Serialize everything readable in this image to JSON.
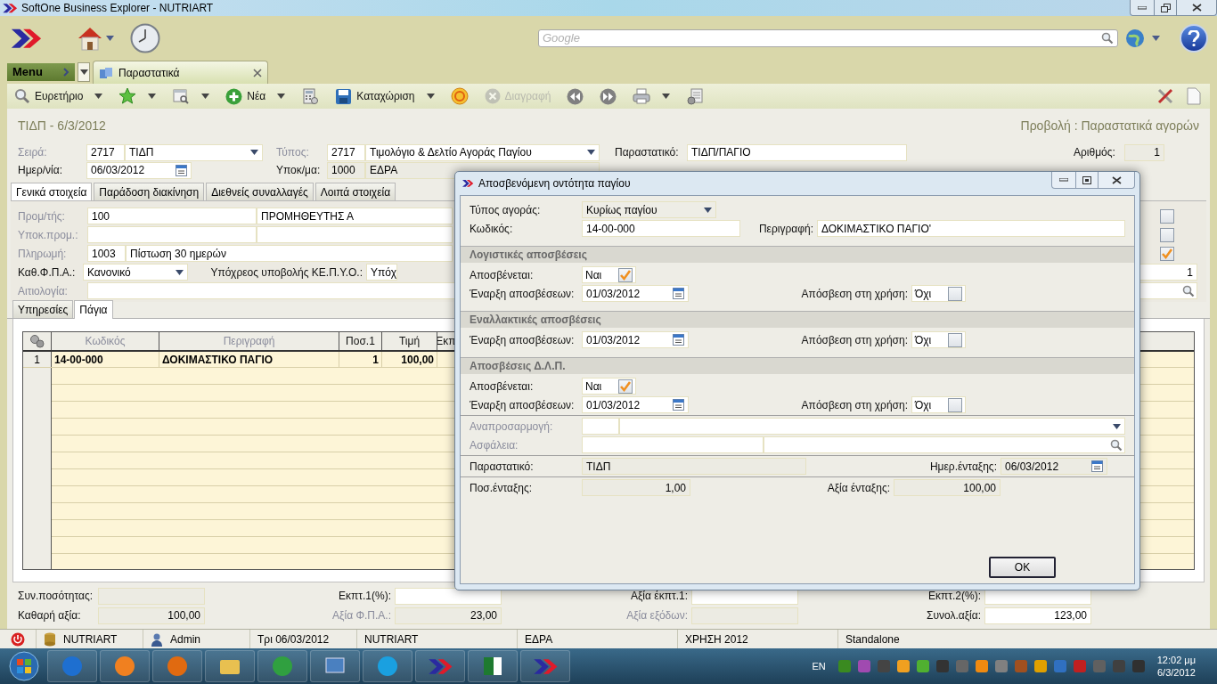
{
  "window": {
    "title": "SoftOne Business Explorer - NUTRIART"
  },
  "search": {
    "placeholder": "Google"
  },
  "menu_button": "Menu",
  "doc_tabs": [
    {
      "label": "Παραστατικά",
      "selected": true
    }
  ],
  "toolbar": [
    {
      "label": "Ευρετήριο",
      "dropdown": true,
      "disabled": false
    },
    {
      "dropdown": true,
      "disabled": false
    },
    {
      "dropdown": true,
      "disabled": false
    },
    {
      "label": "Νέα",
      "dropdown": true,
      "disabled": false
    },
    {
      "dropdown": false,
      "disabled": false
    },
    {
      "label": "Καταχώριση",
      "dropdown": true,
      "disabled": false
    },
    {
      "dropdown": false,
      "disabled": false
    },
    {
      "label": "Διαγραφή",
      "dropdown": false,
      "disabled": true
    },
    {
      "dropdown": false,
      "disabled": false
    },
    {
      "dropdown": false,
      "disabled": false
    },
    {
      "dropdown": true,
      "disabled": false
    },
    {
      "dropdown": false,
      "disabled": false
    }
  ],
  "form": {
    "title": "ΤΙΔΠ - 6/3/2012",
    "view": "Προβολή : Παραστατικά αγορών"
  },
  "header": {
    "series": {
      "label": "Σειρά:",
      "muted": true,
      "code": "2717",
      "value": "ΤΙΔΠ"
    },
    "type": {
      "label": "Τύπος:",
      "muted": true,
      "code": "2717",
      "value": "Τιμολόγιο & Δελτίο Αγοράς Παγίου"
    },
    "document": {
      "label": "Παραστατικό:",
      "muted": false,
      "value": "ΤΙΔΠ/ΠΑΓΙΟ"
    },
    "number": {
      "label": "Αριθμός:",
      "muted": false,
      "value": "1"
    },
    "date": {
      "label": "Ημερ/νία:",
      "muted": false,
      "value": "06/03/2012"
    },
    "branch": {
      "label": "Υποκ/μα:",
      "muted": false,
      "code": "1000",
      "value": "ΕΔΡΑ"
    }
  },
  "tabs": [
    {
      "label": "Γενικά στοιχεία",
      "selected": true
    },
    {
      "label": "Παράδοση διακίνηση",
      "selected": false
    },
    {
      "label": "Διεθνείς συναλλαγές",
      "selected": false
    },
    {
      "label": "Λοιπά στοιχεία",
      "selected": false
    }
  ],
  "general": [
    {
      "kind": "pair",
      "label": "Προμ/τής:",
      "muted": true,
      "code": "100",
      "value": "ΠΡΟΜΗΘΕΥΤΗΣ Α"
    },
    {
      "kind": "pair",
      "label": "Υποκ.προμ.:",
      "muted": true
    },
    {
      "kind": "pair",
      "label": "Πληρωμή:",
      "muted": true,
      "code": "1003",
      "value": "Πίστωση 30 ημερών"
    },
    {
      "kind": "select",
      "label": "Καθ.Φ.Π.Α.:",
      "muted": false,
      "value": "Κανονικό",
      "extra_label": "Υπόχρεος υποβολής ΚΕ.Π.Υ.Ο.:",
      "extra_value": "Υπόχ"
    },
    {
      "kind": "search",
      "label": "Αιτιολογία:",
      "muted": true
    }
  ],
  "side_checks": [
    {
      "checked": false
    },
    {
      "checked": false
    },
    {
      "checked": true
    }
  ],
  "side_value": "1",
  "sub_tabs": [
    {
      "label": "Υπηρεσίες",
      "selected": false
    },
    {
      "label": "Πάγια",
      "selected": true
    }
  ],
  "grid": {
    "columns": [
      {
        "label": "Κωδικός",
        "muted": true
      },
      {
        "label": "Περιγραφή",
        "muted": true
      },
      {
        "label": "Ποσ.1",
        "muted": false
      },
      {
        "label": "Τιμή",
        "muted": false
      },
      {
        "label": "Εκπ",
        "muted": false
      }
    ],
    "rows": [
      {
        "number": "1",
        "cells": [
          "14-00-000",
          "ΔΟΚΙΜΑΣΤΙΚΟ ΠΑΓΙΟ",
          "1",
          "100,00"
        ]
      }
    ]
  },
  "totals": [
    [
      {
        "label": "Συν.ποσότητας:",
        "muted": false,
        "editable": false
      },
      {
        "label": "Εκπτ.1(%):",
        "muted": false,
        "editable": true
      },
      {
        "label": "Αξία έκπτ.1:",
        "muted": false,
        "editable": true
      },
      {
        "label": "Εκπτ.2(%):",
        "muted": false,
        "editable": true
      }
    ],
    [
      {
        "label": "Καθαρή αξία:",
        "muted": false,
        "editable": false,
        "value": "100,00"
      },
      {
        "label": "Αξία Φ.Π.Α.:",
        "muted": true,
        "editable": false,
        "value": "23,00"
      },
      {
        "label": "Αξία εξόδων:",
        "muted": true,
        "editable": false
      },
      {
        "label": "Συνολ.αξία:",
        "muted": false,
        "editable": true,
        "value": "123,00"
      }
    ]
  ],
  "status_bar": [
    "NUTRIART",
    "Admin",
    "Τρι 06/03/2012",
    "NUTRIART",
    "ΕΔΡΑ",
    "ΧΡΗΣΗ 2012",
    "Standalone"
  ],
  "taskbar": {
    "language": "EN",
    "time": "12:02 μμ",
    "date": "6/3/2012"
  },
  "dialog": {
    "title": "Αποσβενόμενη οντότητα παγίου",
    "purchase_type": {
      "label": "Τύπος αγοράς:",
      "value": "Κυρίως παγίου"
    },
    "code": {
      "label": "Κωδικός:",
      "value": "14-00-000"
    },
    "description": {
      "label": "Περιγραφή:",
      "value": "ΔΟΚΙΜΑΣΤΙΚΟ ΠΑΓΙΟ'"
    },
    "sections": [
      {
        "title": "Λογιστικές αποσβέσεις",
        "depreciates": {
          "label": "Αποσβένεται:",
          "value": "Ναι",
          "checked": true
        },
        "start": {
          "label": "Έναρξη αποσβέσεων:",
          "value": "01/03/2012"
        },
        "in_use": {
          "label": "Απόσβεση στη χρήση:",
          "value": "Όχι",
          "checked": false
        }
      },
      {
        "title": "Εναλλακτικές αποσβέσεις",
        "start": {
          "label": "Έναρξη αποσβέσεων:",
          "value": "01/03/2012"
        },
        "in_use": {
          "label": "Απόσβεση στη χρήση:",
          "value": "Όχι",
          "checked": false
        }
      },
      {
        "title": "Αποσβέσεις Δ.Λ.Π.",
        "depreciates": {
          "label": "Αποσβένεται:",
          "value": "Ναι",
          "checked": true
        },
        "start": {
          "label": "Έναρξη αποσβέσεων:",
          "value": "01/03/2012"
        },
        "in_use": {
          "label": "Απόσβεση στη χρήση:",
          "value": "Όχι",
          "checked": false
        }
      }
    ],
    "revaluation": {
      "label": "Αναπροσαρμογή:"
    },
    "insurance": {
      "label": "Ασφάλεια:"
    },
    "document": {
      "label": "Παραστατικό:",
      "value": "ΤΙΔΠ"
    },
    "entry_date": {
      "label": "Ημερ.ένταξης:",
      "value": "06/03/2012"
    },
    "entry_qty": {
      "label": "Ποσ.ένταξης:",
      "value": "1,00"
    },
    "entry_value": {
      "label": "Αξία ένταξης:",
      "value": "100,00"
    },
    "ok": "OK"
  }
}
